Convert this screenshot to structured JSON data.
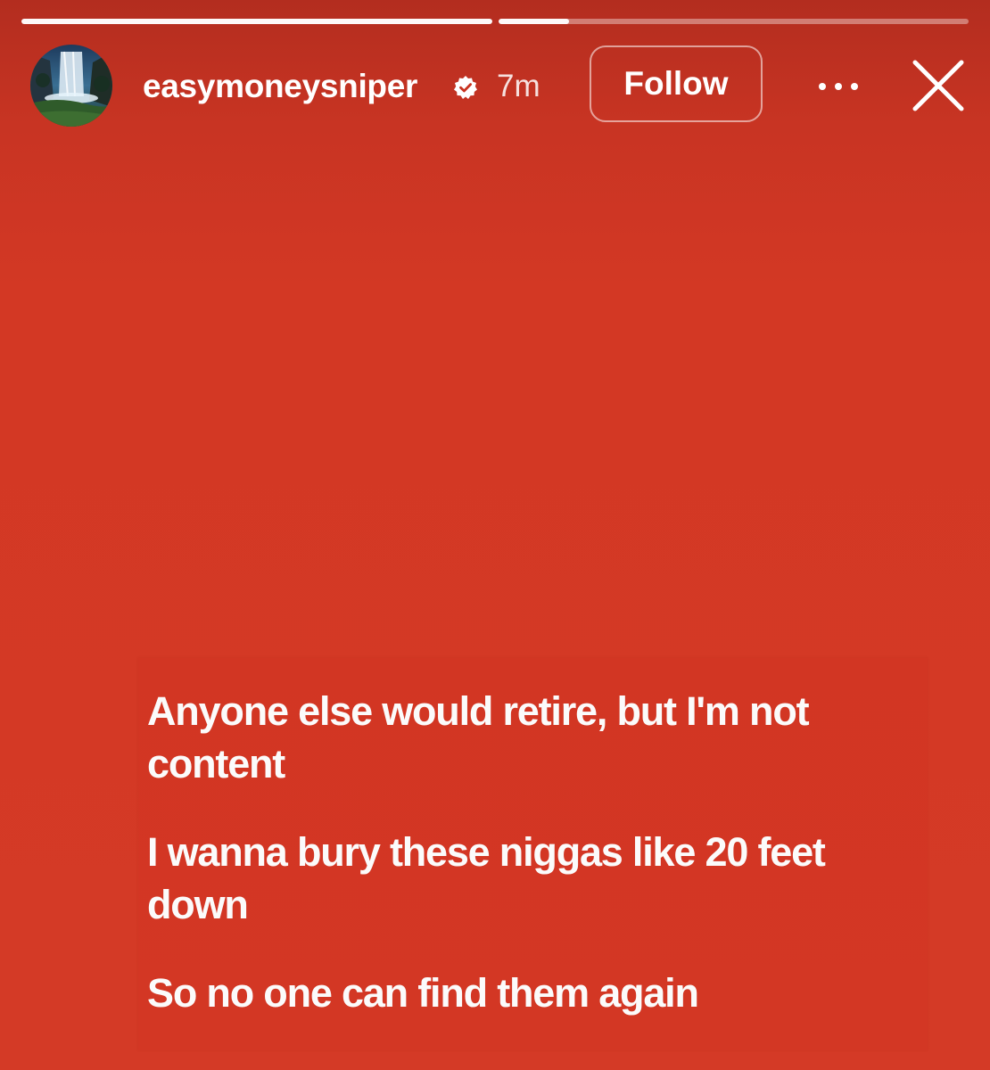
{
  "story": {
    "progress": [
      1.0,
      0.15
    ]
  },
  "header": {
    "avatar_icon": "waterfall-avatar-icon",
    "username": "easymoneysniper",
    "verified_icon": "verified-badge-icon",
    "time": "7m",
    "follow_label": "Follow",
    "more_icon": "ellipsis-icon",
    "close_icon": "close-icon"
  },
  "lyrics": {
    "lines": [
      "Anyone else would retire, but I'm not content",
      "I wanna bury these niggas like 20 feet down",
      "So no one can find them again"
    ]
  },
  "colors": {
    "background": "#d43a26",
    "header_background": "#b32d1f",
    "text": "#ffffff"
  }
}
